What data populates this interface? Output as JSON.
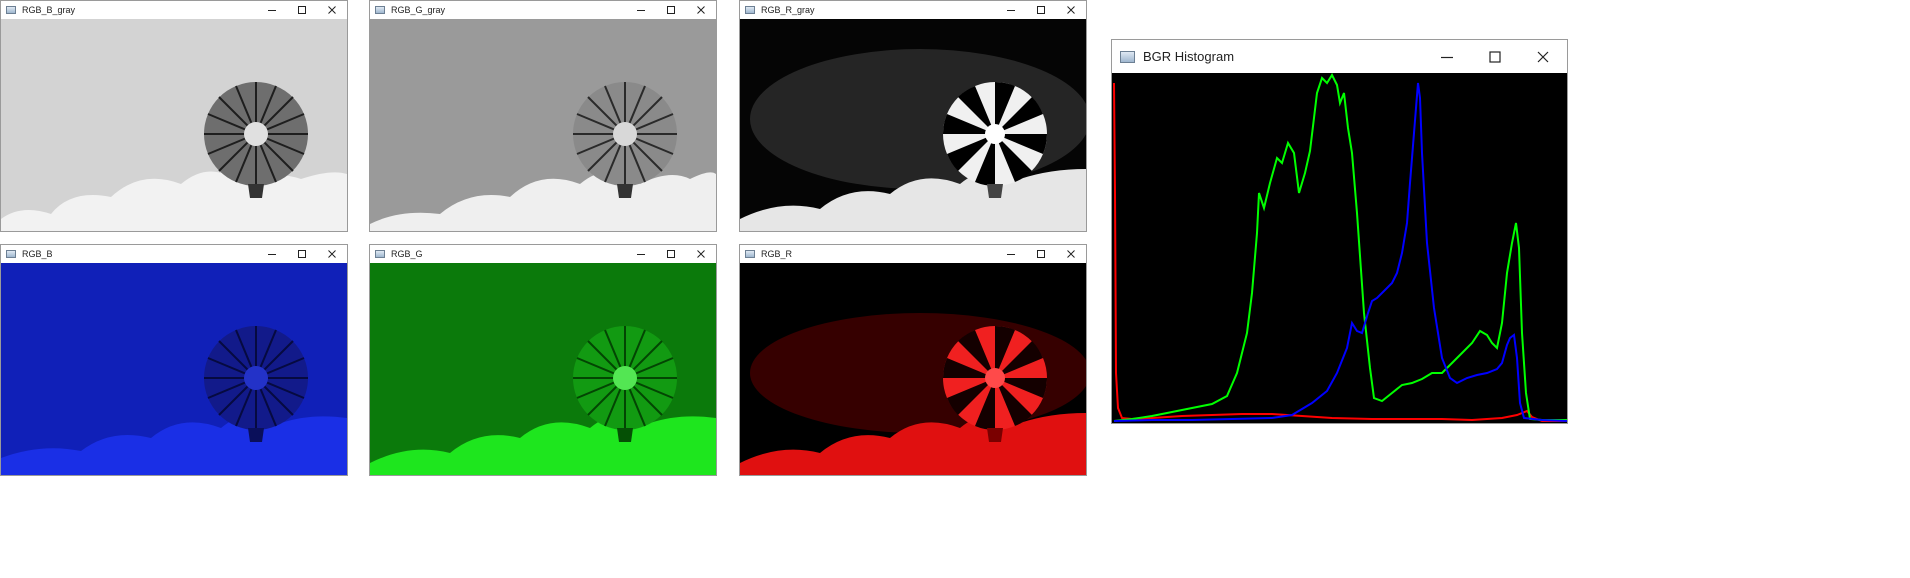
{
  "windows": {
    "b_gray": {
      "title": "RGB_B_gray"
    },
    "g_gray": {
      "title": "RGB_G_gray"
    },
    "r_gray": {
      "title": "RGB_R_gray"
    },
    "b": {
      "title": "RGB_B"
    },
    "g": {
      "title": "RGB_G"
    },
    "r": {
      "title": "RGB_R"
    },
    "histogram": {
      "title": "BGR Histogram"
    }
  },
  "histogram_colors": {
    "blue": "#0000ff",
    "green": "#00ff00",
    "red": "#ff0000"
  }
}
